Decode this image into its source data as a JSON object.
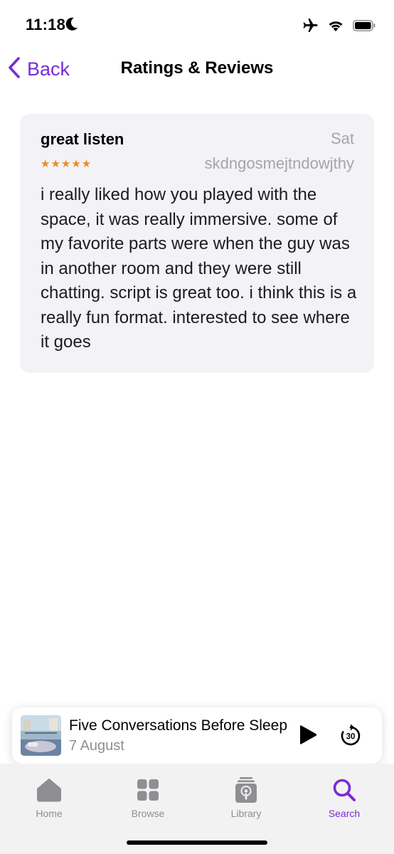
{
  "status_bar": {
    "time": "11:18",
    "icons": [
      "moon-icon",
      "airplane-icon",
      "wifi-icon",
      "battery-icon"
    ]
  },
  "nav": {
    "back_label": "Back",
    "title": "Ratings & Reviews"
  },
  "review": {
    "title": "great listen",
    "date": "Sat",
    "stars": "★★★★★",
    "rating": 5,
    "author": "skdngosmejtndowjthy",
    "body": "i really liked how you played with the space, it was really immersive. some of my favorite parts were when the guy was in another room and they were still chatting. script is great too. i think this is a really fun format. interested to see where it goes"
  },
  "mini_player": {
    "title": "Five Conversations Before Sleep",
    "subtitle": "7 August",
    "play_icon": "play-icon",
    "skip_icon": "skip-forward-30-icon",
    "skip_label": "30"
  },
  "tab_bar": {
    "tabs": [
      {
        "label": "Home",
        "icon": "home-icon",
        "active": false
      },
      {
        "label": "Browse",
        "icon": "grid-icon",
        "active": false
      },
      {
        "label": "Library",
        "icon": "library-icon",
        "active": false
      },
      {
        "label": "Search",
        "icon": "search-icon",
        "active": true
      }
    ]
  },
  "colors": {
    "accent": "#7b2ad8",
    "star": "#f08a1c",
    "card_background": "#f2f2f7",
    "secondary_text": "#a4a4a9",
    "tab_inactive": "#8e8e93"
  }
}
